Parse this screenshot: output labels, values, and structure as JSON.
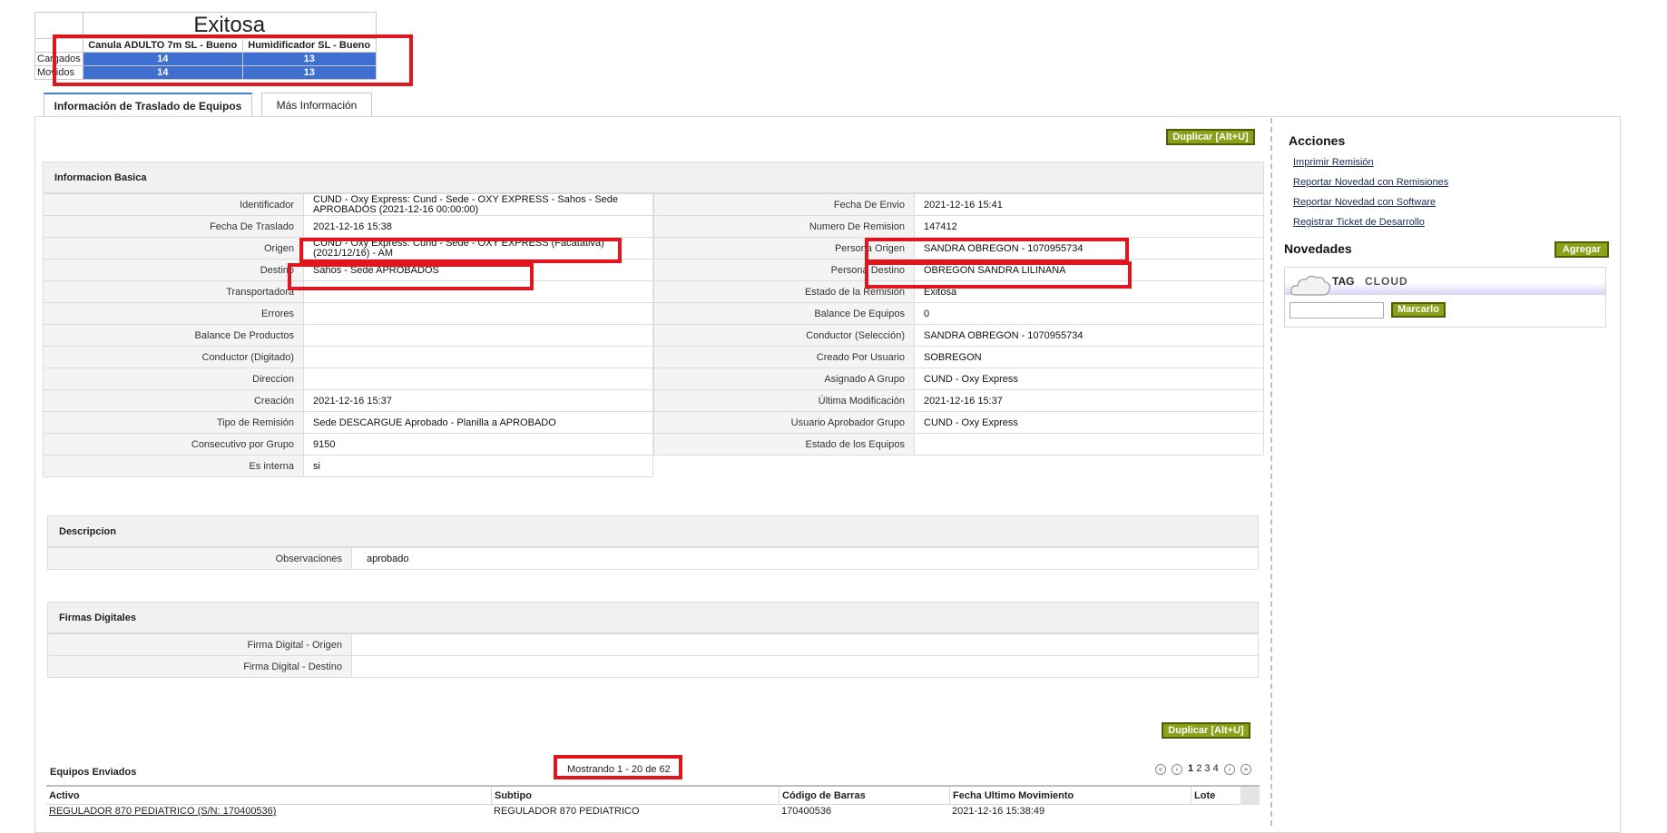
{
  "summary": {
    "title": "Exitosa",
    "columns": [
      "Canula ADULTO 7m SL - Bueno",
      "Humidificador SL - Bueno"
    ],
    "rows": [
      {
        "label": "Cargados",
        "values": [
          "14",
          "13"
        ]
      },
      {
        "label": "Movidos",
        "values": [
          "14",
          "13"
        ]
      }
    ]
  },
  "tabs": [
    {
      "label": "Información de Traslado de Equipos",
      "active": true
    },
    {
      "label": "Más Información",
      "active": false
    }
  ],
  "actions": {
    "duplicate_label": "Duplicar [Alt+U]"
  },
  "basic": {
    "title": "Informacion Basica",
    "left": [
      {
        "label": "Identificador",
        "value": "CUND - Oxy Express: Cund - Sede - OXY EXPRESS - Sahos - Sede APROBADOS (2021-12-16 00:00:00)"
      },
      {
        "label": "Fecha De Traslado",
        "value": "2021-12-16 15:38"
      },
      {
        "label": "Origen",
        "value": "CUND - Oxy Express: Cund - Sede - OXY EXPRESS (Facatativa) (2021/12/16) - AM"
      },
      {
        "label": "Destino",
        "value": "Sahos - Sede APROBADOS"
      },
      {
        "label": "Transportadora",
        "value": ""
      },
      {
        "label": "Errores",
        "value": ""
      },
      {
        "label": "Balance De Productos",
        "value": ""
      },
      {
        "label": "Conductor (Digitado)",
        "value": ""
      },
      {
        "label": "Direccion",
        "value": ""
      },
      {
        "label": "Creación",
        "value": "2021-12-16 15:37"
      },
      {
        "label": "Tipo de Remisión",
        "value": "Sede DESCARGUE Aprobado - Planilla a APROBADO"
      },
      {
        "label": "Consecutivo por Grupo",
        "value": "9150"
      },
      {
        "label": "Es interna",
        "value": "si"
      }
    ],
    "right": [
      {
        "label": "Fecha De Envio",
        "value": "2021-12-16 15:41"
      },
      {
        "label": "Numero De Remision",
        "value": "147412"
      },
      {
        "label": "Persona Origen",
        "value": "SANDRA OBREGON - 1070955734"
      },
      {
        "label": "Persona Destino",
        "value": "OBREGON SANDRA LILINANA"
      },
      {
        "label": "Estado de la Remisión",
        "value": "Exitosa"
      },
      {
        "label": "Balance De Equipos",
        "value": "0"
      },
      {
        "label": "Conductor (Selección)",
        "value": "SANDRA OBREGON - 1070955734"
      },
      {
        "label": "Creado Por Usuario",
        "value": "SOBREGON"
      },
      {
        "label": "Asignado A Grupo",
        "value": "CUND - Oxy Express"
      },
      {
        "label": "Última Modificación",
        "value": "2021-12-16 15:37"
      },
      {
        "label": "Usuario Aprobador Grupo",
        "value": "CUND - Oxy Express"
      },
      {
        "label": "Estado de los Equipos",
        "value": ""
      }
    ]
  },
  "descripcion": {
    "title": "Descripcion",
    "label": "Observaciones",
    "value": "aprobado"
  },
  "firmas": {
    "title": "Firmas Digitales",
    "rows": [
      {
        "label": "Firma Digital - Origen",
        "value": ""
      },
      {
        "label": "Firma Digital - Destino",
        "value": ""
      }
    ]
  },
  "sidebar": {
    "acciones_title": "Acciones",
    "links": [
      "Imprimir Remisión",
      "Reportar Novedad con Remisiones",
      "Reportar Novedad con Software",
      "Registrar Ticket de Desarrollo"
    ],
    "novedades_title": "Novedades",
    "agregar_label": "Agregar",
    "tag_word1": "TAG",
    "tag_word2": "CLOUD",
    "marcarlo_label": "Marcarlo"
  },
  "equipos": {
    "title": "Equipos Enviados",
    "showing": "Mostrando 1 - 20 de 62",
    "pages": [
      "1",
      "2",
      "3",
      "4"
    ],
    "columns": [
      "Activo",
      "Subtipo",
      "Código de Barras",
      "Fecha Ultimo Movimiento",
      "Lote"
    ],
    "first_row": [
      "REGULADOR 870 PEDIATRICO (S/N: 170400536)",
      "REGULADOR 870 PEDIATRICO",
      "170400536",
      "2021-12-16 15:38:49",
      ""
    ]
  },
  "colors": {
    "accent_green": "#8aa11a",
    "highlight_red": "#e0161e",
    "summary_blue": "#3f6fcf",
    "tab_blue": "#3f7fd0"
  }
}
